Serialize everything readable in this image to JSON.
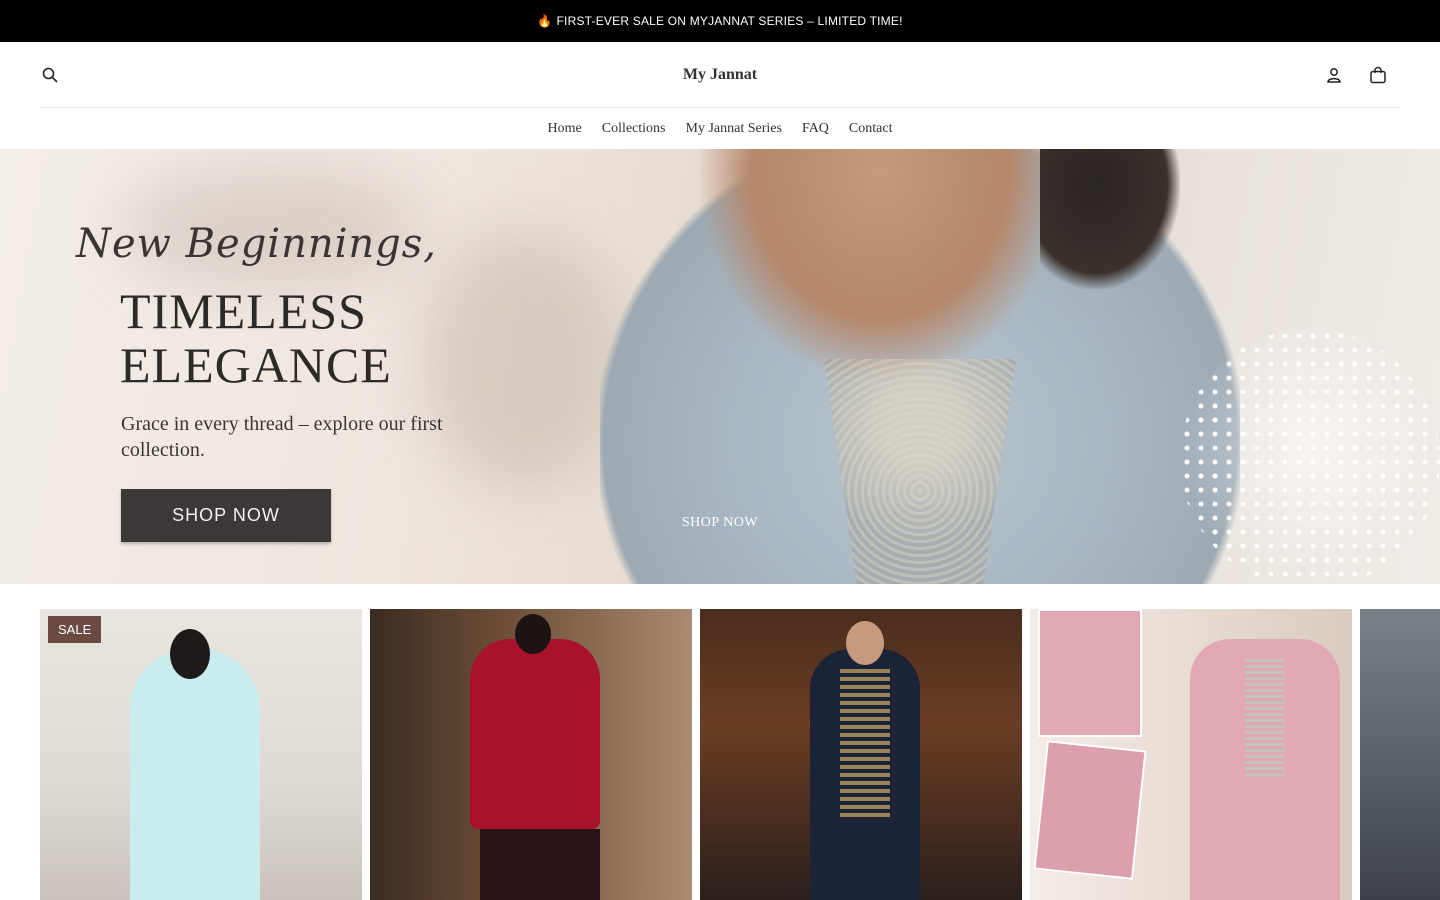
{
  "announcement": {
    "icon": "flame-icon",
    "text": "FIRST-EVER SALE ON MYJANNAT SERIES – LIMITED TIME!"
  },
  "header": {
    "logo": "My Jannat",
    "search_icon": "search-icon",
    "account_icon": "user-icon",
    "cart_icon": "bag-icon"
  },
  "nav": {
    "items": [
      {
        "label": "Home"
      },
      {
        "label": "Collections"
      },
      {
        "label": "My Jannat Series"
      },
      {
        "label": "FAQ"
      },
      {
        "label": "Contact"
      }
    ]
  },
  "hero": {
    "script_text": "New Beginnings,",
    "title_line1": "TIMELESS",
    "title_line2": "ELEGANCE",
    "subtitle": "Grace in every thread – explore our first collection.",
    "button_label": "SHOP NOW",
    "overlay_link": "SHOP NOW"
  },
  "products": {
    "badge": "SALE",
    "colors": {
      "p1": "#c9ecef",
      "p2": "#a8122a",
      "p3": "#1b2436",
      "p4": "#e2a9b4"
    }
  }
}
